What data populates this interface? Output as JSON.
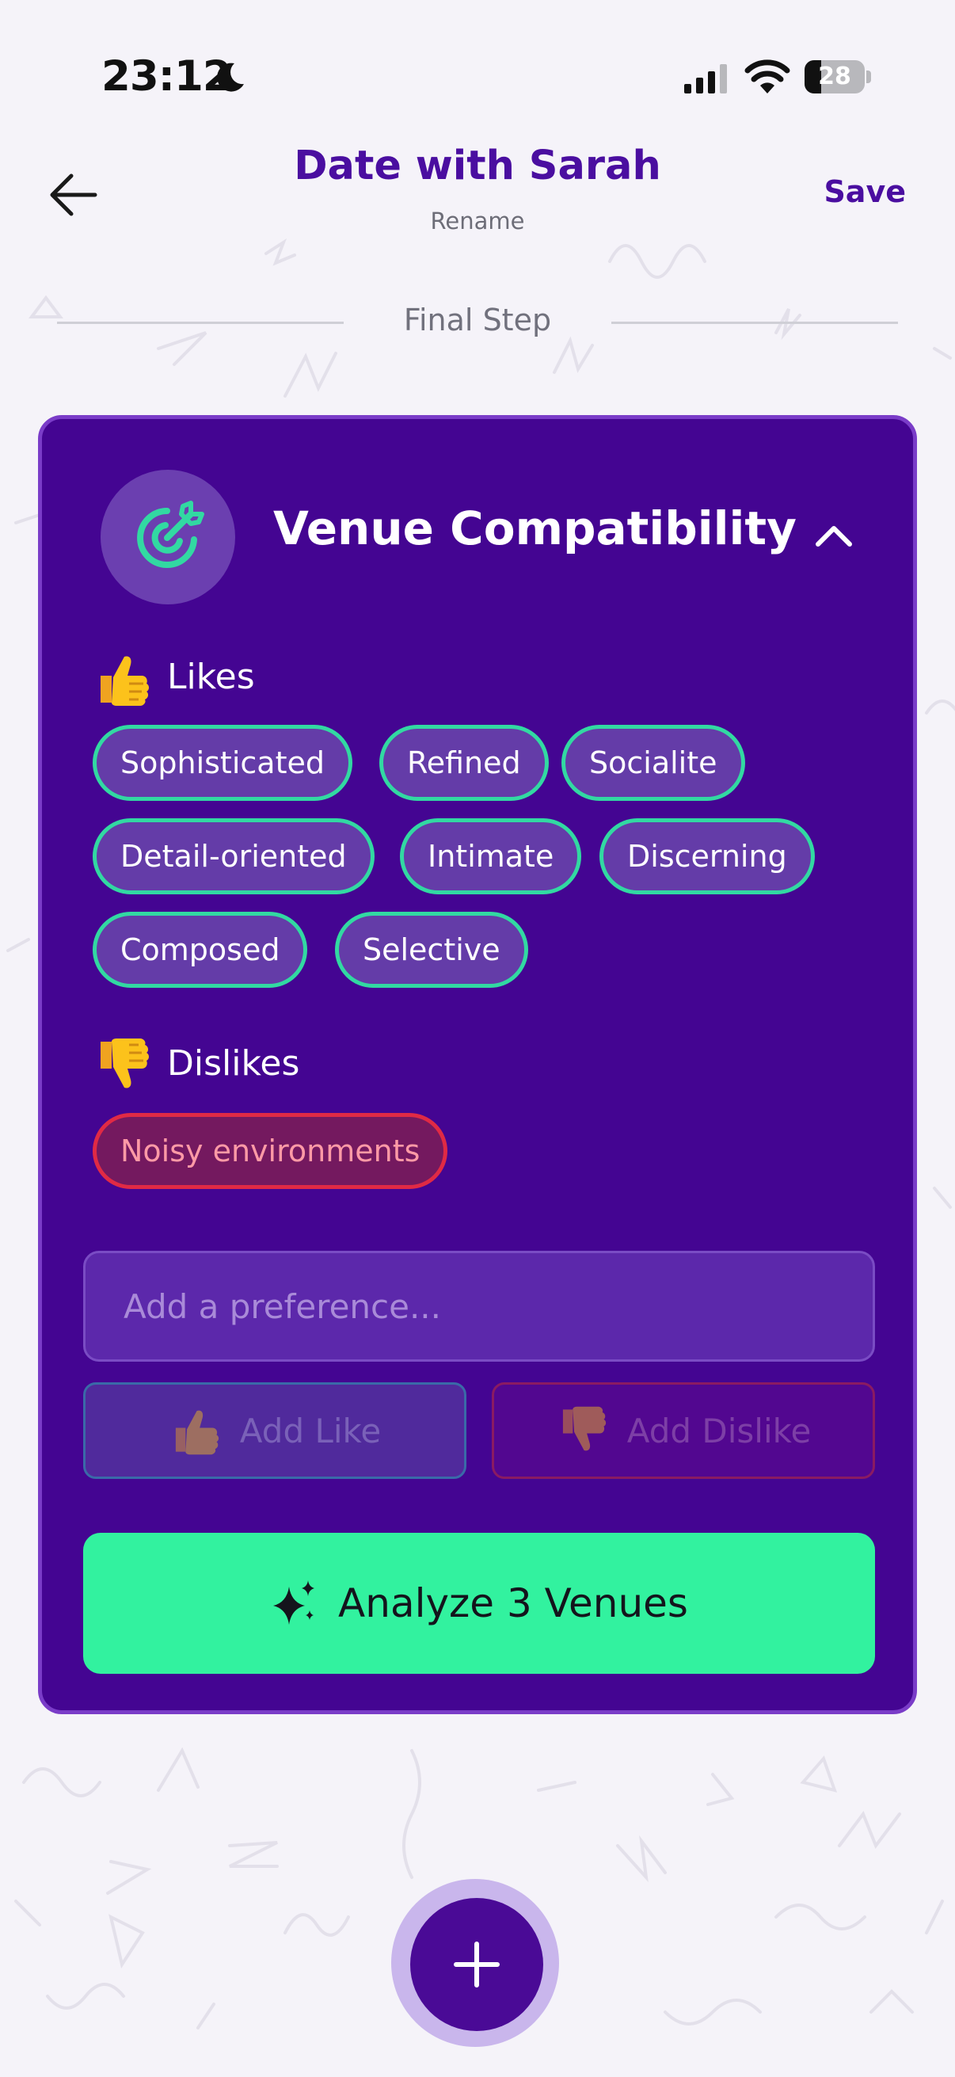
{
  "status_bar": {
    "time": "23:12",
    "battery_level": "28",
    "battery_fraction": 0.28,
    "icons": [
      "moon-icon",
      "signal-icon",
      "wifi-icon",
      "battery-icon"
    ]
  },
  "header": {
    "title": "Date with Sarah",
    "subtitle": "Rename",
    "save_label": "Save",
    "back_icon": "arrow-left-icon"
  },
  "step": {
    "label": "Final Step"
  },
  "card": {
    "title": "Venue Compatibility",
    "icon": "target-icon",
    "collapse_icon": "chevron-up-icon",
    "likes": {
      "label": "Likes",
      "icon": "thumbs-up-icon",
      "items": [
        "Sophisticated",
        "Refined",
        "Socialite",
        "Detail-oriented",
        "Intimate",
        "Discerning",
        "Composed",
        "Selective"
      ]
    },
    "dislikes": {
      "label": "Dislikes",
      "icon": "thumbs-down-icon",
      "items": [
        "Noisy environments"
      ]
    },
    "input": {
      "placeholder": "Add a preference...",
      "value": ""
    },
    "add_like_label": "Add Like",
    "add_dislike_label": "Add Dislike",
    "analyze_label": "Analyze 3 Venues",
    "analyze_icon": "sparkles-icon"
  },
  "fab": {
    "icon": "plus-icon"
  },
  "colors": {
    "brand_purple": "#4a0ea0",
    "card_bg": "#440592",
    "like_border": "#32d9a2",
    "dislike_border": "#e02a45",
    "analyze_bg": "#32f29f",
    "page_bg": "#f5f3f9"
  }
}
